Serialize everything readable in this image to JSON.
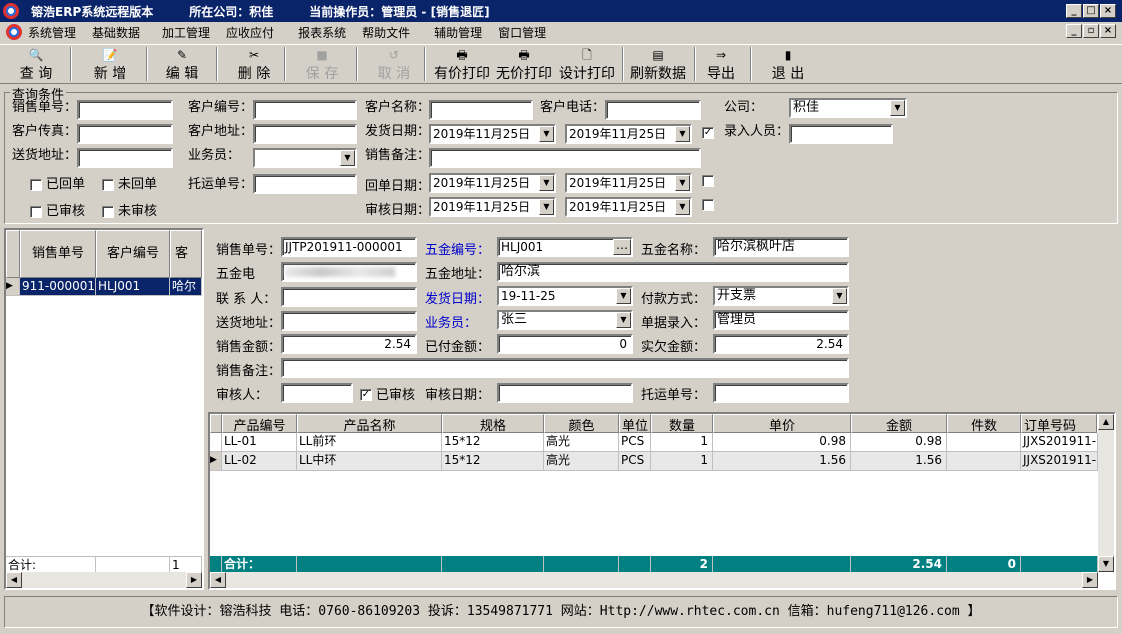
{
  "titlebar": {
    "app": "镕浩ERP系统远程版本",
    "company": "所在公司：积佳",
    "operator": "当前操作员：管理员 - [销售退匠]"
  },
  "menu": [
    "系统管理",
    "基础数据",
    "加工管理",
    "应收应付",
    "报表系统",
    "帮助文件",
    "辅助管理",
    "窗口管理"
  ],
  "toolbar": {
    "query": "查 询",
    "new": "新 增",
    "edit": "编 辑",
    "delete": "删 除",
    "save": "保 存",
    "cancel": "取 消",
    "print_price": "有价打印",
    "print_noprice": "无价打印",
    "design_print": "设计打印",
    "refresh": "刷新数据",
    "export": "导出",
    "exit": "退 出"
  },
  "filter": {
    "title": "查询条件",
    "sales_no": "销售单号：",
    "cust_no": "客户编号：",
    "cust_name": "客户名称：",
    "cust_phone": "客户电话：",
    "company": "公司：",
    "company_value": "积佳",
    "cust_fax": "客户传真：",
    "cust_addr": "客户地址：",
    "ship_date": "发货日期：",
    "ship_from": "2019年11月25日",
    "ship_to": "2019年11月25日",
    "entry_user": "录入人员：",
    "deliver_addr": "送货地址：",
    "salesman": "业务员：",
    "sales_note": "销售备注：",
    "returned": "已回单",
    "not_returned": "未回单",
    "consign_no": "托运单号：",
    "return_date": "回单日期：",
    "return_from": "2019年11月25日",
    "return_to": "2019年11月25日",
    "audited": "已审核",
    "not_audited": "未审核",
    "audit_date": "审核日期：",
    "audit_from": "2019年11月25日",
    "audit_to": "2019年11月25日"
  },
  "left_grid": {
    "headers": [
      "销售单号",
      "客户编号",
      "客"
    ],
    "rows": [
      {
        "no": "911-000001",
        "cust": "HLJ001",
        "name": "哈尔"
      }
    ],
    "total_label": "合计:",
    "total_value": "1"
  },
  "detail": {
    "sales_no_label": "销售单号：",
    "sales_no": "JJTP201911-000001",
    "hw_no_label": "五金编号：",
    "hw_no": "HLJ001",
    "hw_name_label": "五金名称：",
    "hw_name": "哈尔滨枫叶店",
    "hw_phone_label": "五金电",
    "hw_addr_label": "五金地址：",
    "hw_addr": "哈尔滨",
    "contact_label": "联 系 人：",
    "ship_date_label": "发货日期：",
    "ship_date": "19-11-25",
    "pay_label": "付款方式：",
    "pay": "开支票",
    "deliver_label": "送货地址：",
    "salesman_label": "业务员：",
    "salesman": "张三",
    "entry_label": "单据录入：",
    "entry": "管理员",
    "amount_label": "销售金额：",
    "amount": "2.54",
    "paid_label": "已付金额：",
    "paid": "0",
    "owed_label": "实欠金额：",
    "owed": "2.54",
    "note_label": "销售备注：",
    "auditor_label": "审核人：",
    "audited_label": "已审核",
    "audit_date_label": "审核日期：",
    "consign_label": "托运单号："
  },
  "items": {
    "headers": [
      "产品编号",
      "产品名称",
      "规格",
      "颜色",
      "单位",
      "数量",
      "单价",
      "金额",
      "件数",
      "订单号码"
    ],
    "rows": [
      {
        "code": "LL-01",
        "name": "LL前环",
        "spec": "15*12",
        "color": "高光",
        "unit": "PCS",
        "qty": "1",
        "price": "0.98",
        "amount": "0.98",
        "pieces": "",
        "order": "JJXS201911-"
      },
      {
        "code": "LL-02",
        "name": "LL中环",
        "spec": "15*12",
        "color": "高光",
        "unit": "PCS",
        "qty": "1",
        "price": "1.56",
        "amount": "1.56",
        "pieces": "",
        "order": "JJXS201911-"
      }
    ],
    "total_label": "合计：",
    "total_qty": "2",
    "total_amount": "2.54",
    "total_pieces": "0"
  },
  "status": "【软件设计：镕浩科技 电话：0760-86109203 投诉：13549871771 网站：Http://www.rhtec.com.cn 信箱：hufeng711@126.com 】"
}
